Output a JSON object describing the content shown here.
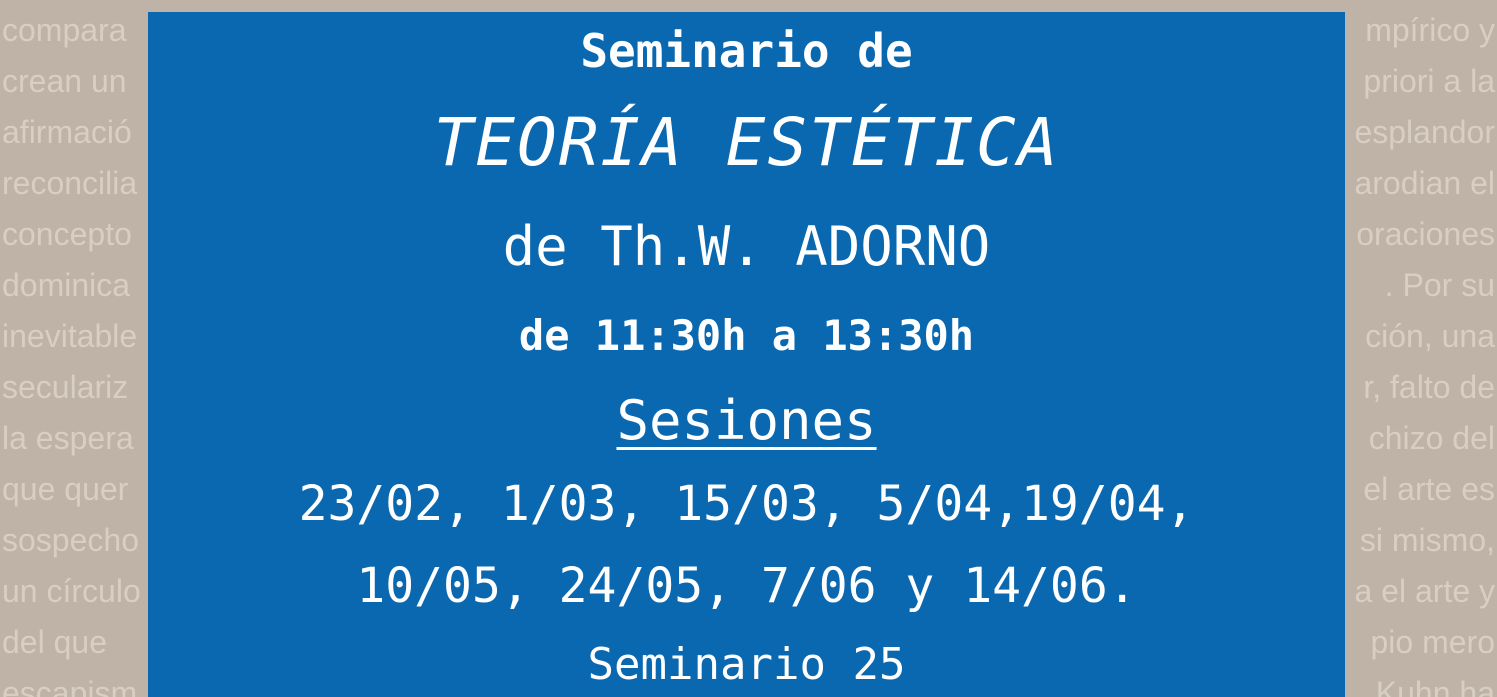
{
  "background_text": {
    "left": [
      "compara",
      "crean un",
      "afirmació",
      "reconcilia",
      "concepto",
      "dominica",
      "inevitable",
      "seculariz",
      "la espera",
      "que quer",
      "sospecho",
      "un círculo",
      "del que",
      "escapism"
    ],
    "right": [
      "mpírico y",
      "priori a la",
      "esplandor",
      "arodian el",
      "oraciones",
      ". Por su",
      "ción, una",
      "r, falto de",
      "chizo del",
      "el arte es",
      "si mismo,",
      "a el arte y",
      "pio mero",
      "Kuhn ha"
    ]
  },
  "poster": {
    "line1": "Seminario de",
    "title": "TEORÍA ESTÉTICA",
    "author": "de Th.W. ADORNO",
    "time": "de 11:30h a 13:30h",
    "sessions_heading": "Sesiones",
    "dates_line1": "23/02, 1/03, 15/03, 5/04,19/04,",
    "dates_line2": "10/05, 24/05, 7/06 y 14/06.",
    "room": "Seminario 25"
  },
  "colors": {
    "background": "#bfb2a6",
    "background_text": "#d8cec4",
    "panel": "#0a68b0",
    "text": "#ffffff"
  }
}
